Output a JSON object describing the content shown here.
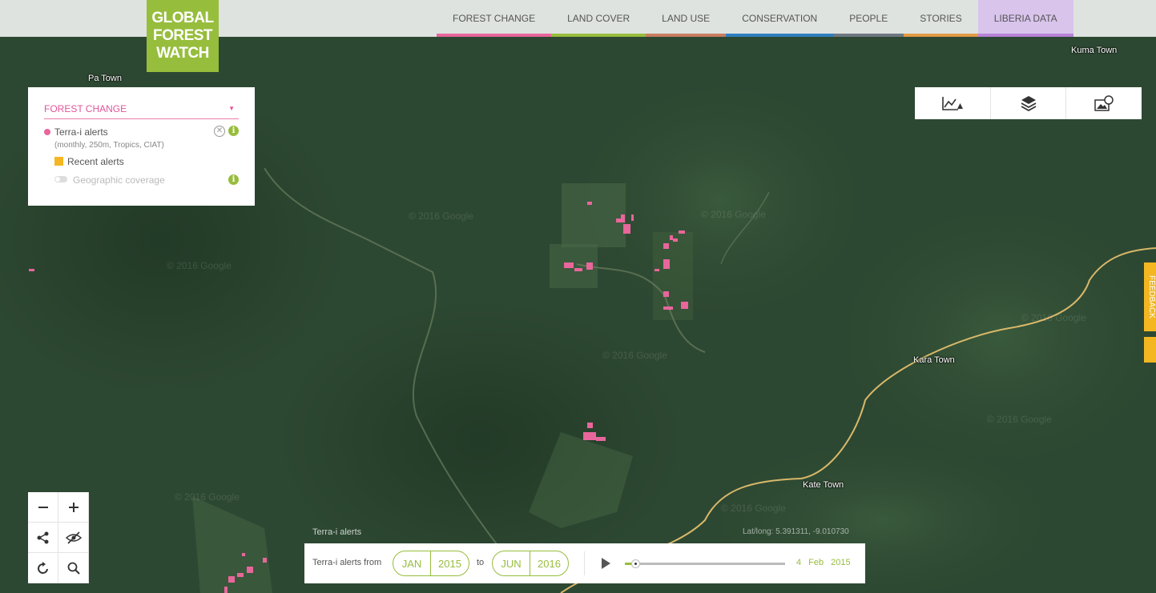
{
  "logo": {
    "line1": "GLOBAL",
    "line2": "FOREST",
    "line3": "WATCH"
  },
  "nav": [
    {
      "label": "FOREST CHANGE",
      "color": "#e8669b"
    },
    {
      "label": "LAND COVER",
      "color": "#97bd3d"
    },
    {
      "label": "LAND USE",
      "color": "#c87d61"
    },
    {
      "label": "CONSERVATION",
      "color": "#2f7fbf"
    },
    {
      "label": "PEOPLE",
      "color": "#6e7781"
    },
    {
      "label": "STORIES",
      "color": "#e49a45"
    },
    {
      "label": "LIBERIA DATA",
      "color": "#b784d6"
    }
  ],
  "legend": {
    "title": "FOREST CHANGE",
    "layer_name": "Terra-i alerts",
    "layer_meta": "(monthly, 250m, Tropics, CIAT)",
    "recent_label": "Recent alerts",
    "geo_label": "Geographic coverage",
    "layer_color": "#e8669b",
    "recent_color": "#f4b722"
  },
  "tools": [
    "analysis-alert-icon",
    "layers-icon",
    "basemap-icon"
  ],
  "feedback": {
    "label": "FEEDBACK"
  },
  "places": {
    "pa_town": "Pa Town",
    "kuma_town": "Kuma Town",
    "kara_town": "Kara Town",
    "kate_town": "Kate Town"
  },
  "map_watermark": "© 2016 Google",
  "map": {
    "alert_color": "#e8669b",
    "road_color": "#d9b86a"
  },
  "map_overlay": {
    "layer_caption": "Terra-i alerts",
    "latlong": "Lat/long: 5.391311, -9.010730"
  },
  "timeline": {
    "prefix": "Terra-i alerts from",
    "from_month": "JAN",
    "from_year": "2015",
    "to_word": "to",
    "to_month": "JUN",
    "to_year": "2016",
    "current_date": "4  Feb  2015",
    "progress": 0.04
  }
}
